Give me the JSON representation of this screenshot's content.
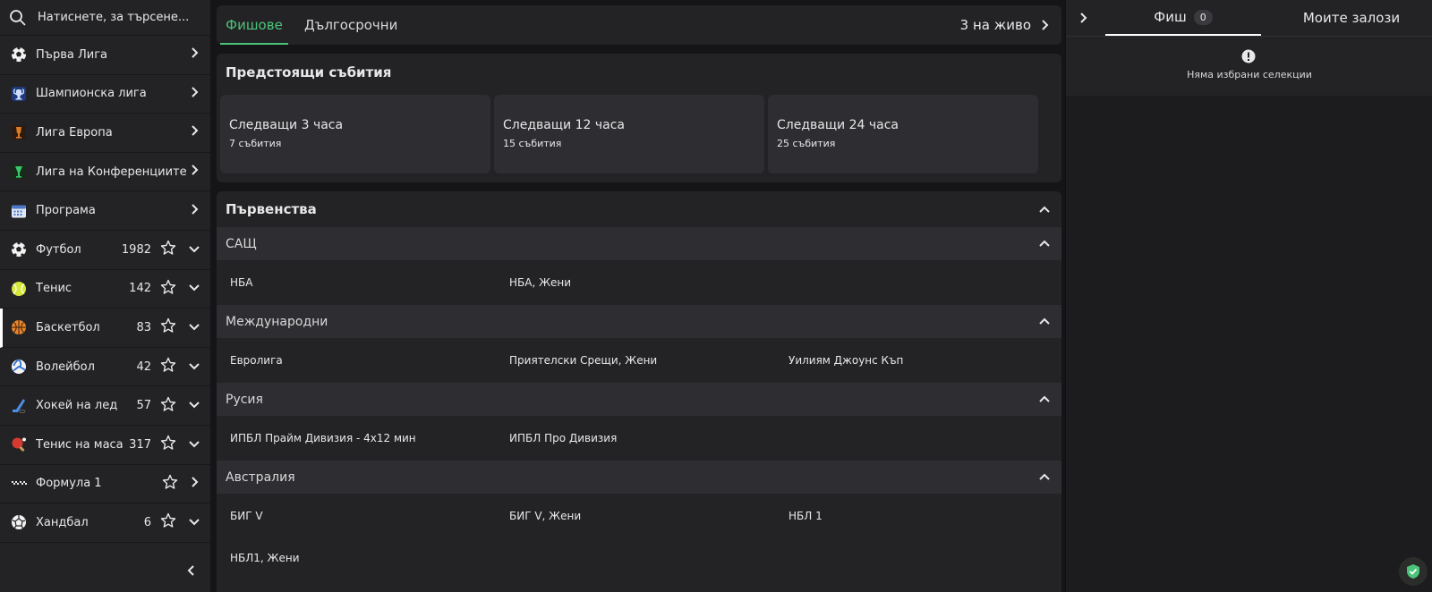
{
  "search": {
    "placeholder": "Натиснете, за търсене..."
  },
  "sidebar": {
    "items": [
      {
        "label": "Първа Лига",
        "icon": "soccer-ball-icon",
        "count": "",
        "star": false,
        "chevron": "right"
      },
      {
        "label": "Шампионска лига",
        "icon": "champions-trophy-icon",
        "count": "",
        "star": false,
        "chevron": "right"
      },
      {
        "label": "Лига Европа",
        "icon": "europa-trophy-icon",
        "count": "",
        "star": false,
        "chevron": "right"
      },
      {
        "label": "Лига на Конференциите",
        "icon": "conference-trophy-icon",
        "count": "",
        "star": false,
        "chevron": "right"
      },
      {
        "label": "Програма",
        "icon": "calendar-icon",
        "count": "",
        "star": false,
        "chevron": "right"
      },
      {
        "label": "Футбол",
        "icon": "soccer-ball-icon",
        "count": "1982",
        "star": true,
        "chevron": "down"
      },
      {
        "label": "Тенис",
        "icon": "tennis-ball-icon",
        "count": "142",
        "star": true,
        "chevron": "down"
      },
      {
        "label": "Баскетбол",
        "icon": "basketball-icon",
        "count": "83",
        "star": true,
        "chevron": "down",
        "active": true
      },
      {
        "label": "Волейбол",
        "icon": "volleyball-icon",
        "count": "42",
        "star": true,
        "chevron": "down"
      },
      {
        "label": "Хокей на лед",
        "icon": "hockey-stick-icon",
        "count": "57",
        "star": true,
        "chevron": "down"
      },
      {
        "label": "Тенис на маса",
        "icon": "ping-pong-icon",
        "count": "317",
        "star": true,
        "chevron": "down"
      },
      {
        "label": "Формула 1",
        "icon": "racing-flag-icon",
        "count": "",
        "star": true,
        "chevron": "right"
      },
      {
        "label": "Хандбал",
        "icon": "handball-icon",
        "count": "6",
        "star": true,
        "chevron": "down"
      }
    ]
  },
  "main": {
    "tabs": [
      {
        "label": "Фишове",
        "active": true
      },
      {
        "label": "Дългосрочни",
        "active": false
      }
    ],
    "live_label": "3 на живо",
    "upcoming": {
      "title": "Предстоящи събития",
      "cards": [
        {
          "title": "Следващи 3 часа",
          "sub": "7 събития"
        },
        {
          "title": "Следващи 12 часа",
          "sub": "15 събития"
        },
        {
          "title": "Следващи 24 часа",
          "sub": "25 събития"
        }
      ]
    },
    "championships": {
      "title": "Първенства",
      "groups": [
        {
          "country": "САЩ",
          "leagues": [
            "НБА",
            "НБА, Жени"
          ]
        },
        {
          "country": "Международни",
          "leagues": [
            "Евролига",
            "Приятелски Срещи, Жени",
            "Уилиям Джоунс Къп"
          ]
        },
        {
          "country": "Русия",
          "leagues": [
            "ИПБЛ Прайм Дивизия - 4х12 мин",
            "ИПБЛ Про Дивизия"
          ]
        },
        {
          "country": "Австралия",
          "leagues": [
            "БИГ V",
            "БИГ V, Жени",
            "НБЛ 1",
            "НБЛ1, Жени"
          ]
        }
      ]
    }
  },
  "betslip": {
    "tab_slip": "Фиш",
    "slip_count": "0",
    "tab_my_bets": "Моите залози",
    "empty_text": "Няма избрани селекции"
  },
  "colors": {
    "accent": "#4cc37a",
    "background": "#151517",
    "panel": "#232326",
    "card": "#2e2e32"
  }
}
